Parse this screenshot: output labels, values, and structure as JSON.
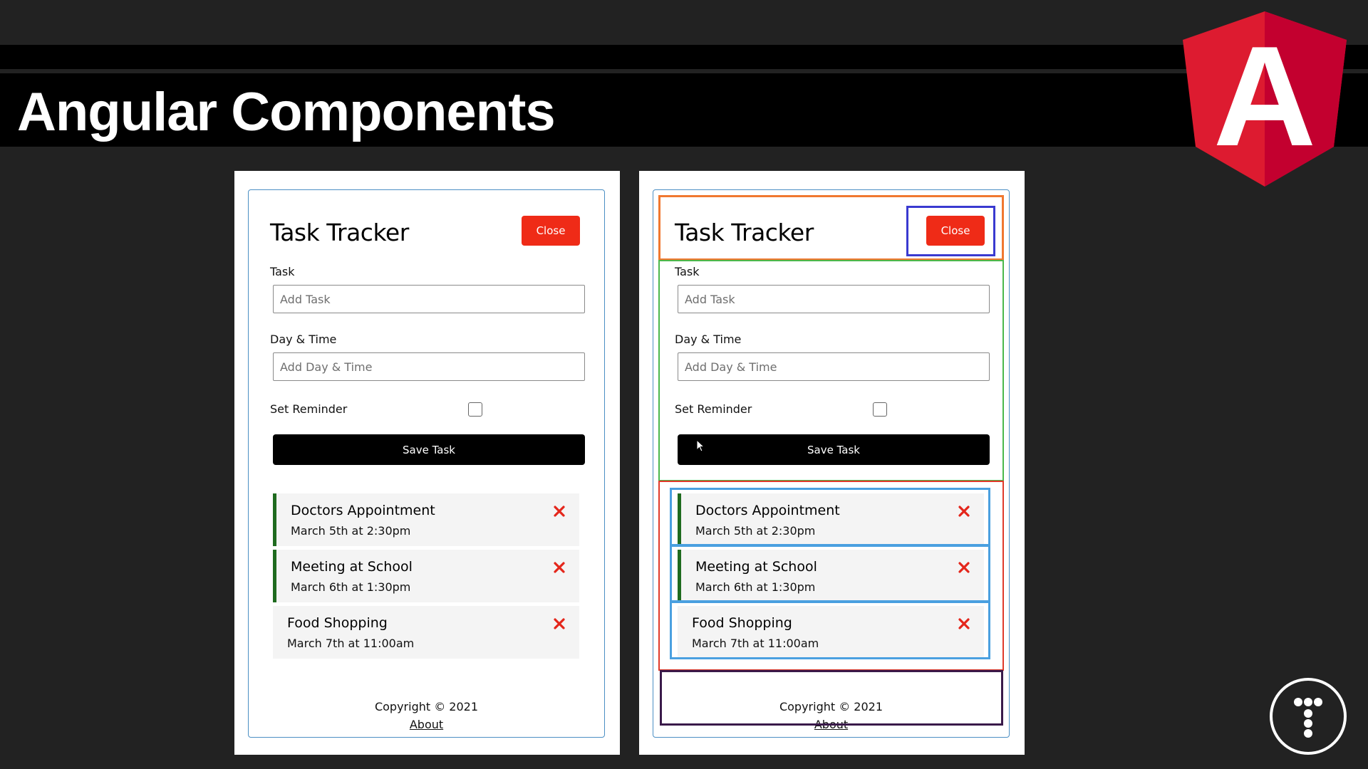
{
  "slide": {
    "title": "Angular Components"
  },
  "logos": {
    "angular_letter": "A"
  },
  "app": {
    "title": "Task Tracker",
    "close_label": "Close",
    "task_label": "Task",
    "task_placeholder": "Add Task",
    "day_label": "Day & Time",
    "day_placeholder": "Add Day & Time",
    "reminder_label": "Set Reminder",
    "reminder_checked": false,
    "save_label": "Save Task",
    "tasks": [
      {
        "text": "Doctors Appointment",
        "day": "March 5th at 2:30pm",
        "reminder": true
      },
      {
        "text": "Meeting at School",
        "day": "March 6th at 1:30pm",
        "reminder": true
      },
      {
        "text": "Food Shopping",
        "day": "March 7th at 11:00am",
        "reminder": false
      }
    ],
    "footer_copyright": "Copyright © 2021",
    "footer_about": "About"
  },
  "colors": {
    "close_button": "#ef2b17",
    "delete_icon": "#e4261b",
    "reminder_border": "#1f6b1f",
    "header_component_outline": "#f07830",
    "button_component_outline": "#3a3ad0",
    "add_task_component_outline": "#4bb84b",
    "tasks_component_outline": "#e03a2a",
    "task_item_component_outline": "#4aa0e0",
    "footer_component_outline": "#3a1a4a"
  }
}
